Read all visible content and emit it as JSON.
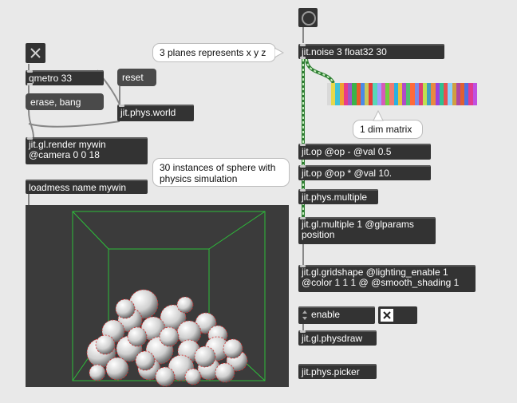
{
  "objects": {
    "qmetro": "qmetro 33",
    "erase_bang": "erase, bang",
    "reset": "reset",
    "phys_world": "jit.phys.world",
    "render_line1": "jit.gl.render mywin",
    "render_line2": "@camera 0 0 18",
    "loadmess": "loadmess name mywin",
    "noise": "jit.noise 3 float32 30",
    "op_minus": "jit.op @op - @val 0.5",
    "op_times": "jit.op @op * @val 10.",
    "phys_multiple": "jit.phys.multiple",
    "gl_multiple_line1": "jit.gl.multiple 1 @glparams",
    "gl_multiple_line2": "position",
    "gridshape_line1": "jit.gl.gridshape @lighting_enable 1",
    "gridshape_line2": "@color 1 1 1 @ @smooth_shading 1",
    "enable_menu": "enable",
    "physdraw": "jit.gl.physdraw",
    "phys_picker": "jit.phys.picker"
  },
  "comments": {
    "planes": "3 planes represents x y z",
    "dim_matrix": "1 dim matrix",
    "instances": "30 instances of sphere with physics simulation"
  },
  "matrix_colors": [
    "#d9d9d9",
    "#e8d84a",
    "#3fc2d8",
    "#f0a030",
    "#e83a8a",
    "#9a58c8",
    "#39b34a",
    "#e85a2a",
    "#4a8ae8",
    "#c8c85a",
    "#e83a3a",
    "#58d8b8",
    "#a0a0ff",
    "#d85ab8",
    "#70d040",
    "#f07a70",
    "#2ab0e0",
    "#e8c040",
    "#b04ac8",
    "#50c070",
    "#ff6a3a",
    "#7a8ae8",
    "#e04070",
    "#c0e050",
    "#40a0c0",
    "#e88a40",
    "#9a40e0",
    "#30c090",
    "#e85050",
    "#8ad0ff",
    "#d0a040",
    "#b048a0",
    "#e06030",
    "#5070e0",
    "#e03a90",
    "#c050e0"
  ],
  "colors": {
    "background": "#e9e9e9",
    "object_bg": "#333333",
    "cord_dark": "#8a8a8a",
    "cord_matrix": "#3aa84a"
  }
}
